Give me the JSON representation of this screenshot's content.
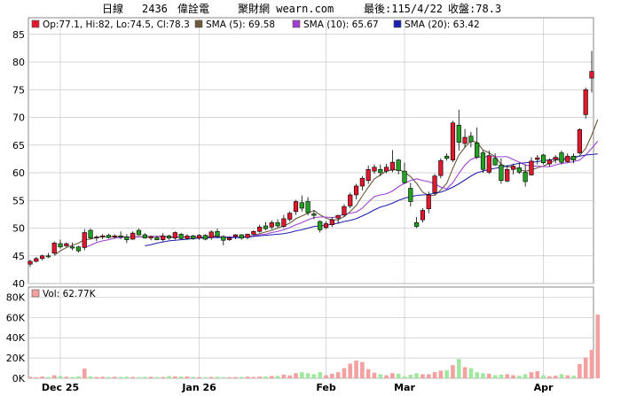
{
  "header": {
    "period": "日線",
    "stock_code": "2436",
    "stock_name": "偉詮電",
    "site": "聚財網 wearn.com",
    "last_date_label": "最後:115/4/22",
    "close_label": "收盤:78.3"
  },
  "colors": {
    "up": "#e0182d",
    "down": "#22a022",
    "sma5": "#6b5a3a",
    "sma10": "#a040d0",
    "sma20": "#2020b0",
    "vol_up": "#f2a0a0",
    "vol_down": "#a0e8a0",
    "grid": "#c8c8c8",
    "frame": "#888888"
  },
  "chart_data": [
    {
      "type": "candlestick",
      "title": "",
      "legend": [
        {
          "key": "ohlc",
          "label": "Op:77.1, Hi:82, Lo:74.5, Cl:78.3",
          "color": "#e0182d"
        },
        {
          "key": "sma5",
          "label": "SMA (5): 69.58",
          "color": "#6b5a3a"
        },
        {
          "key": "sma10",
          "label": "SMA (10): 65.67",
          "color": "#a040d0"
        },
        {
          "key": "sma20",
          "label": "SMA (20): 63.42",
          "color": "#2020b0"
        }
      ],
      "ylim": [
        40,
        88
      ],
      "yticks": [
        40,
        45,
        50,
        55,
        60,
        65,
        70,
        75,
        80,
        85
      ],
      "x_month_labels": [
        {
          "label": "Dec 25",
          "index": 5
        },
        {
          "label": "Jan 26",
          "index": 28
        },
        {
          "label": "Feb",
          "index": 49
        },
        {
          "label": "Mar",
          "index": 62
        },
        {
          "label": "Apr",
          "index": 85
        }
      ],
      "candles": [
        [
          43.5,
          44.3,
          43.0,
          44.0
        ],
        [
          44.0,
          44.8,
          43.8,
          44.5
        ],
        [
          44.5,
          45.2,
          44.2,
          45.0
        ],
        [
          45.0,
          45.5,
          44.6,
          44.8
        ],
        [
          45.5,
          47.6,
          45.2,
          47.3
        ],
        [
          47.2,
          47.9,
          46.3,
          46.6
        ],
        [
          46.8,
          47.4,
          46.6,
          47.2
        ],
        [
          46.6,
          47.4,
          46.0,
          46.4
        ],
        [
          46.6,
          46.8,
          45.6,
          45.9
        ],
        [
          46.5,
          49.8,
          46.0,
          49.2
        ],
        [
          49.6,
          49.9,
          48.0,
          48.2
        ],
        [
          48.3,
          48.7,
          47.6,
          48.4
        ],
        [
          48.4,
          48.9,
          48.0,
          48.6
        ],
        [
          48.7,
          49.0,
          48.1,
          48.3
        ],
        [
          48.4,
          48.9,
          48.1,
          48.6
        ],
        [
          48.6,
          49.4,
          48.0,
          48.4
        ],
        [
          48.4,
          48.9,
          47.3,
          47.9
        ],
        [
          48.0,
          49.4,
          47.9,
          49.1
        ],
        [
          49.6,
          49.9,
          48.7,
          48.8
        ],
        [
          48.8,
          49.1,
          48.1,
          48.2
        ],
        [
          48.2,
          48.6,
          47.8,
          48.5
        ],
        [
          48.3,
          48.6,
          47.8,
          47.9
        ],
        [
          47.9,
          49.1,
          47.6,
          48.6
        ],
        [
          48.6,
          48.8,
          47.9,
          48.2
        ],
        [
          48.2,
          49.4,
          47.9,
          49.2
        ],
        [
          48.9,
          49.1,
          47.9,
          48.1
        ],
        [
          48.1,
          48.9,
          47.9,
          48.6
        ],
        [
          48.6,
          48.8,
          47.9,
          48.1
        ],
        [
          48.2,
          48.9,
          47.9,
          48.7
        ],
        [
          48.7,
          48.9,
          47.8,
          48.0
        ],
        [
          48.3,
          49.6,
          47.9,
          49.3
        ],
        [
          49.4,
          49.9,
          48.2,
          48.5
        ],
        [
          48.5,
          48.7,
          46.9,
          47.8
        ],
        [
          47.9,
          48.5,
          47.7,
          48.2
        ],
        [
          48.5,
          48.9,
          48.0,
          48.8
        ],
        [
          48.8,
          48.9,
          47.9,
          48.2
        ],
        [
          48.3,
          49.0,
          48.0,
          48.9
        ],
        [
          48.9,
          49.6,
          48.8,
          49.4
        ],
        [
          49.4,
          50.6,
          49.2,
          50.2
        ],
        [
          50.4,
          51.1,
          49.6,
          49.9
        ],
        [
          50.2,
          51.4,
          49.8,
          51.0
        ],
        [
          51.0,
          51.6,
          50.1,
          50.4
        ],
        [
          50.3,
          52.4,
          50.0,
          51.7
        ],
        [
          51.6,
          53.0,
          51.2,
          52.7
        ],
        [
          53.0,
          55.1,
          52.4,
          54.8
        ],
        [
          54.6,
          55.9,
          53.0,
          53.6
        ],
        [
          54.8,
          55.6,
          52.3,
          52.8
        ],
        [
          52.6,
          53.2,
          51.6,
          52.3
        ],
        [
          51.2,
          51.4,
          49.2,
          49.7
        ],
        [
          50.1,
          51.2,
          49.8,
          50.8
        ],
        [
          50.6,
          52.0,
          50.2,
          51.5
        ],
        [
          51.8,
          52.4,
          50.8,
          52.3
        ],
        [
          52.4,
          54.3,
          52.0,
          53.9
        ],
        [
          54.0,
          56.4,
          53.6,
          56.0
        ],
        [
          56.0,
          58.0,
          55.2,
          57.6
        ],
        [
          57.6,
          59.4,
          56.8,
          59.0
        ],
        [
          58.6,
          61.3,
          58.0,
          60.6
        ],
        [
          60.3,
          61.5,
          59.8,
          61.0
        ],
        [
          60.6,
          61.5,
          59.4,
          60.0
        ],
        [
          60.3,
          61.6,
          59.9,
          61.0
        ],
        [
          60.5,
          64.1,
          60.1,
          61.9
        ],
        [
          62.3,
          62.5,
          59.7,
          60.4
        ],
        [
          60.3,
          61.8,
          58.0,
          58.2
        ],
        [
          57.2,
          58.2,
          53.9,
          54.8
        ],
        [
          51.0,
          52.0,
          50.0,
          50.3
        ],
        [
          51.5,
          53.6,
          51.0,
          53.2
        ],
        [
          53.5,
          56.6,
          52.7,
          56.0
        ],
        [
          56.4,
          59.8,
          56.0,
          59.4
        ],
        [
          59.5,
          62.6,
          59.0,
          62.2
        ],
        [
          63.0,
          63.5,
          62.2,
          62.6
        ],
        [
          62.3,
          69.4,
          61.9,
          69.0
        ],
        [
          68.6,
          71.4,
          64.0,
          65.5
        ],
        [
          65.3,
          67.9,
          64.6,
          66.4
        ],
        [
          66.6,
          67.4,
          64.6,
          65.6
        ],
        [
          65.4,
          68.2,
          62.5,
          62.8
        ],
        [
          63.6,
          64.0,
          60.0,
          60.6
        ],
        [
          60.1,
          64.0,
          59.8,
          63.1
        ],
        [
          62.6,
          63.5,
          61.3,
          61.4
        ],
        [
          61.4,
          62.6,
          58.0,
          58.6
        ],
        [
          58.5,
          61.4,
          58.3,
          60.6
        ],
        [
          60.6,
          61.6,
          59.7,
          61.2
        ],
        [
          60.9,
          61.8,
          59.8,
          60.1
        ],
        [
          60.1,
          61.5,
          57.5,
          58.4
        ],
        [
          59.6,
          62.8,
          59.5,
          62.1
        ],
        [
          62.4,
          63.2,
          61.5,
          62.7
        ],
        [
          63.2,
          63.4,
          61.5,
          61.8
        ],
        [
          61.6,
          62.6,
          61.1,
          62.3
        ],
        [
          62.4,
          63.2,
          61.7,
          62.8
        ],
        [
          63.6,
          64.0,
          61.5,
          61.9
        ],
        [
          62.0,
          63.5,
          61.8,
          63.0
        ],
        [
          63.0,
          63.5,
          61.7,
          62.3
        ],
        [
          63.6,
          68.0,
          63.4,
          67.8
        ],
        [
          70.5,
          75.4,
          69.8,
          75.0
        ],
        [
          77.1,
          82.0,
          74.5,
          78.3
        ]
      ],
      "sma5": [
        null,
        null,
        null,
        null,
        45.1,
        45.9,
        46.5,
        46.9,
        47.3,
        47.9,
        48.0,
        48.3,
        48.5,
        48.4,
        48.5,
        48.5,
        48.4,
        48.4,
        48.5,
        48.4,
        48.5,
        48.5,
        48.6,
        48.3,
        48.4,
        48.4,
        48.4,
        48.4,
        48.4,
        48.3,
        48.6,
        48.5,
        48.4,
        48.4,
        48.4,
        48.4,
        48.4,
        48.7,
        49.0,
        49.3,
        49.6,
        50.0,
        50.4,
        50.9,
        51.7,
        52.2,
        52.7,
        53.2,
        52.4,
        51.8,
        51.5,
        51.5,
        52.1,
        53.0,
        54.1,
        55.8,
        57.4,
        58.9,
        59.6,
        60.3,
        60.5,
        60.6,
        60.1,
        59.3,
        58.1,
        56.5,
        55.9,
        55.9,
        56.9,
        58.1,
        60.8,
        63.2,
        64.6,
        65.8,
        65.5,
        64.1,
        63.6,
        62.9,
        61.5,
        61.1,
        61.0,
        60.6,
        60.3,
        60.5,
        60.9,
        61.2,
        61.7,
        62.3,
        62.3,
        62.4,
        62.5,
        63.1,
        64.4,
        66.8,
        69.6
      ],
      "sma10": [
        null,
        null,
        null,
        null,
        null,
        null,
        null,
        null,
        null,
        46.5,
        46.9,
        47.4,
        47.7,
        47.9,
        48.2,
        48.3,
        48.4,
        48.4,
        48.4,
        48.5,
        48.5,
        48.5,
        48.5,
        48.4,
        48.4,
        48.4,
        48.4,
        48.4,
        48.4,
        48.3,
        48.4,
        48.4,
        48.4,
        48.4,
        48.4,
        48.4,
        48.5,
        48.6,
        48.8,
        48.9,
        49.2,
        49.4,
        49.7,
        50.1,
        50.6,
        51.0,
        51.5,
        51.9,
        52.0,
        52.0,
        51.9,
        52.1,
        52.5,
        52.7,
        52.9,
        53.6,
        54.7,
        55.7,
        56.0,
        56.2,
        56.7,
        57.5,
        58.1,
        58.6,
        58.9,
        58.6,
        58.4,
        58.0,
        57.4,
        57.1,
        58.2,
        59.9,
        61.4,
        62.4,
        62.8,
        62.9,
        62.9,
        62.9,
        62.9,
        62.9,
        62.4,
        61.9,
        61.4,
        61.2,
        61.2,
        61.1,
        61.1,
        61.4,
        61.7,
        61.8,
        62.0,
        62.3,
        63.2,
        64.4,
        65.7
      ],
      "sma20": [
        null,
        null,
        null,
        null,
        null,
        null,
        null,
        null,
        null,
        null,
        null,
        null,
        null,
        null,
        null,
        null,
        null,
        null,
        null,
        46.8,
        47.0,
        47.3,
        47.5,
        47.7,
        47.8,
        47.9,
        48.0,
        48.1,
        48.2,
        48.2,
        48.3,
        48.3,
        48.3,
        48.3,
        48.3,
        48.3,
        48.4,
        48.5,
        48.6,
        48.7,
        48.8,
        48.9,
        49.0,
        49.2,
        49.5,
        49.7,
        50.0,
        50.3,
        50.4,
        50.5,
        50.7,
        50.9,
        51.2,
        51.4,
        51.7,
        52.2,
        52.7,
        53.3,
        53.8,
        54.1,
        54.5,
        55.0,
        55.4,
        55.7,
        55.9,
        56.0,
        56.1,
        56.3,
        56.5,
        56.9,
        57.4,
        58.0,
        58.7,
        59.4,
        60.0,
        60.3,
        60.6,
        60.8,
        61.0,
        61.2,
        61.5,
        61.7,
        61.8,
        61.9,
        62.0,
        62.2,
        62.3,
        62.5,
        62.6,
        62.6,
        62.8,
        63.0,
        63.2,
        63.3,
        63.4
      ]
    },
    {
      "type": "bar",
      "title": "",
      "legend": [
        {
          "key": "vol",
          "label": "Vol: 62.77K",
          "color": "#f2a0a0"
        }
      ],
      "ylim": [
        0,
        90
      ],
      "yticks": [
        {
          "value": 0,
          "label": "0K"
        },
        {
          "value": 20,
          "label": "20K"
        },
        {
          "value": 40,
          "label": "40K"
        },
        {
          "value": 60,
          "label": "60K"
        },
        {
          "value": 80,
          "label": "80K"
        }
      ],
      "unit": "K",
      "values": [
        1.5,
        1.0,
        1.8,
        1.2,
        3.0,
        2.2,
        1.5,
        1.3,
        2.0,
        9.5,
        2.0,
        1.3,
        1.4,
        1.2,
        1.5,
        1.4,
        1.6,
        1.3,
        1.2,
        1.4,
        1.5,
        1.2,
        1.3,
        2.2,
        1.9,
        1.7,
        1.8,
        1.4,
        1.2,
        1.1,
        1.3,
        1.5,
        1.2,
        1.1,
        1.2,
        1.4,
        1.6,
        1.3,
        1.6,
        1.8,
        2.2,
        2.3,
        3.5,
        2.8,
        5.0,
        6.0,
        5.0,
        4.0,
        6.0,
        3.0,
        4.5,
        6.0,
        10.0,
        14.5,
        17.5,
        16.0,
        9.0,
        5.5,
        4.0,
        3.0,
        5.0,
        4.5,
        2.0,
        3.5,
        5.0,
        4.0,
        4.0,
        6.0,
        7.5,
        8.0,
        13.0,
        19.0,
        11.0,
        10.0,
        6.0,
        5.0,
        4.5,
        3.0,
        3.5,
        4.0,
        3.0,
        2.5,
        4.0,
        6.0,
        7.0,
        3.0,
        2.0,
        2.5,
        4.0,
        3.0,
        2.5,
        14.0,
        20.5,
        28.0,
        62.8
      ],
      "directions": [
        1,
        1,
        1,
        -1,
        1,
        -1,
        1,
        -1,
        -1,
        1,
        -1,
        1,
        1,
        -1,
        1,
        -1,
        -1,
        1,
        -1,
        -1,
        1,
        -1,
        1,
        -1,
        1,
        -1,
        1,
        -1,
        1,
        -1,
        1,
        -1,
        -1,
        1,
        1,
        -1,
        1,
        1,
        1,
        -1,
        1,
        -1,
        1,
        1,
        1,
        -1,
        -1,
        -1,
        -1,
        1,
        1,
        1,
        1,
        1,
        1,
        1,
        1,
        1,
        -1,
        1,
        1,
        -1,
        -1,
        -1,
        -1,
        1,
        1,
        1,
        1,
        -1,
        1,
        -1,
        1,
        -1,
        -1,
        -1,
        1,
        -1,
        -1,
        1,
        1,
        -1,
        -1,
        1,
        1,
        -1,
        1,
        1,
        -1,
        1,
        -1,
        1,
        1,
        1,
        1
      ]
    }
  ]
}
